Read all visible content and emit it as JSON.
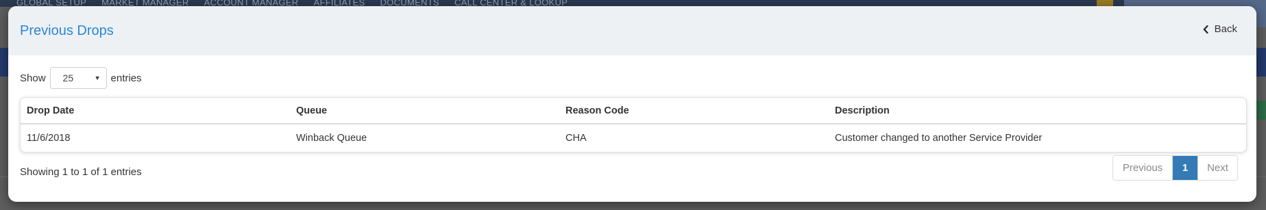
{
  "background": {
    "nav_items": [
      "GLOBAL SETUP",
      "MARKET MANAGER",
      "ACCOUNT MANAGER",
      "AFFILIATES",
      "DOCUMENTS",
      "CALL CENTER & LOOKUP"
    ]
  },
  "modal": {
    "title": "Previous Drops",
    "back_label": "Back",
    "length": {
      "show_label": "Show",
      "selected_value": "25",
      "entries_label": "entries"
    },
    "table": {
      "headers": [
        "Drop Date",
        "Queue",
        "Reason Code",
        "Description"
      ],
      "rows": [
        [
          "11/6/2018",
          "Winback Queue",
          "CHA",
          "Customer changed to another Service Provider"
        ]
      ]
    },
    "info": "Showing 1 to 1 of 1 entries",
    "pagination": {
      "previous_label": "Previous",
      "current_page": "1",
      "next_label": "Next"
    }
  },
  "colors": {
    "title": "#2a86d6",
    "active_page": "#337ab7",
    "header_bg": "#eef1f4"
  },
  "icons": {
    "back": "chevron-left-icon",
    "select": "caret-down-icon"
  }
}
